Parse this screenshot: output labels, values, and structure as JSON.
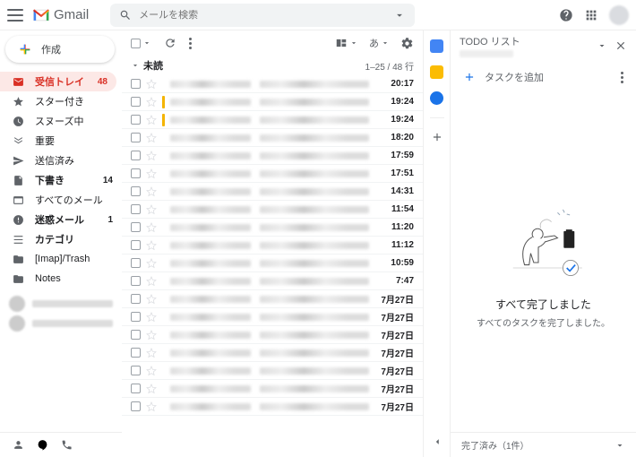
{
  "header": {
    "app": "Gmail",
    "search_placeholder": "メールを検索"
  },
  "compose": "作成",
  "sidebar": {
    "items": [
      {
        "label": "受信トレイ",
        "count": "48"
      },
      {
        "label": "スター付き",
        "count": ""
      },
      {
        "label": "スヌーズ中",
        "count": ""
      },
      {
        "label": "重要",
        "count": ""
      },
      {
        "label": "送信済み",
        "count": ""
      },
      {
        "label": "下書き",
        "count": "14"
      },
      {
        "label": "すべてのメール",
        "count": ""
      },
      {
        "label": "迷惑メール",
        "count": "1"
      },
      {
        "label": "カテゴリ",
        "count": ""
      },
      {
        "label": "[Imap]/Trash",
        "count": ""
      },
      {
        "label": "Notes",
        "count": ""
      }
    ]
  },
  "section": {
    "label": "未読",
    "range": "1–25 / 48 行"
  },
  "emails": [
    {
      "time": "20:17",
      "unread": true,
      "mk": false
    },
    {
      "time": "19:24",
      "unread": true,
      "mk": true
    },
    {
      "time": "19:24",
      "unread": true,
      "mk": true
    },
    {
      "time": "18:20",
      "unread": true,
      "mk": false
    },
    {
      "time": "17:59",
      "unread": true,
      "mk": false
    },
    {
      "time": "17:51",
      "unread": true,
      "mk": false
    },
    {
      "time": "14:31",
      "unread": true,
      "mk": false
    },
    {
      "time": "11:54",
      "unread": true,
      "mk": false
    },
    {
      "time": "11:20",
      "unread": true,
      "mk": false
    },
    {
      "time": "11:12",
      "unread": true,
      "mk": false
    },
    {
      "time": "10:59",
      "unread": true,
      "mk": false
    },
    {
      "time": "7:47",
      "unread": true,
      "mk": false
    },
    {
      "time": "7月27日",
      "unread": true,
      "mk": false
    },
    {
      "time": "7月27日",
      "unread": true,
      "mk": false
    },
    {
      "time": "7月27日",
      "unread": true,
      "mk": false
    },
    {
      "time": "7月27日",
      "unread": true,
      "mk": false
    },
    {
      "time": "7月27日",
      "unread": true,
      "mk": false
    },
    {
      "time": "7月27日",
      "unread": true,
      "mk": false
    },
    {
      "time": "7月27日",
      "unread": true,
      "mk": false
    }
  ],
  "tasks": {
    "title": "TODO リスト",
    "add": "タスクを追加",
    "done_title": "すべて完了しました",
    "done_desc": "すべてのタスクを完了しました。",
    "footer": "完了済み（1件）"
  },
  "lang": "あ"
}
